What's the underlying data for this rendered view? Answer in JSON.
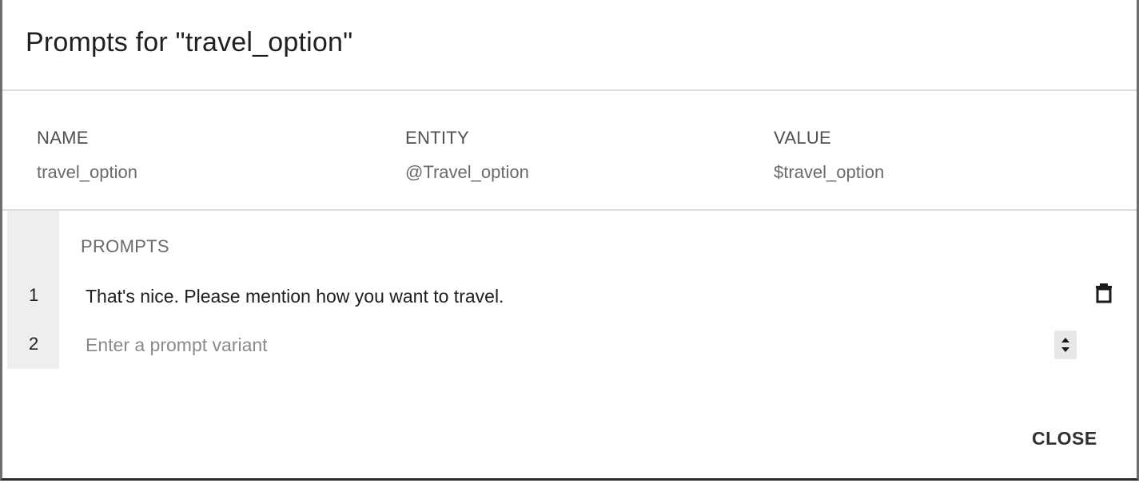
{
  "dialog": {
    "title": "Prompts for \"travel_option\""
  },
  "parameter": {
    "name_label": "NAME",
    "name_value": "travel_option",
    "entity_label": "ENTITY",
    "entity_value": "@Travel_option",
    "value_label": "VALUE",
    "value_value": "$travel_option"
  },
  "prompts": {
    "heading": "PROMPTS",
    "items": [
      {
        "number": "1",
        "text": "That's nice. Please mention how you want to travel."
      },
      {
        "number": "2",
        "text": ""
      }
    ],
    "new_placeholder": "Enter a prompt variant"
  },
  "footer": {
    "close_label": "CLOSE"
  },
  "icons": {
    "delete": "trash-icon",
    "stepper": "up-down-stepper-icon"
  }
}
